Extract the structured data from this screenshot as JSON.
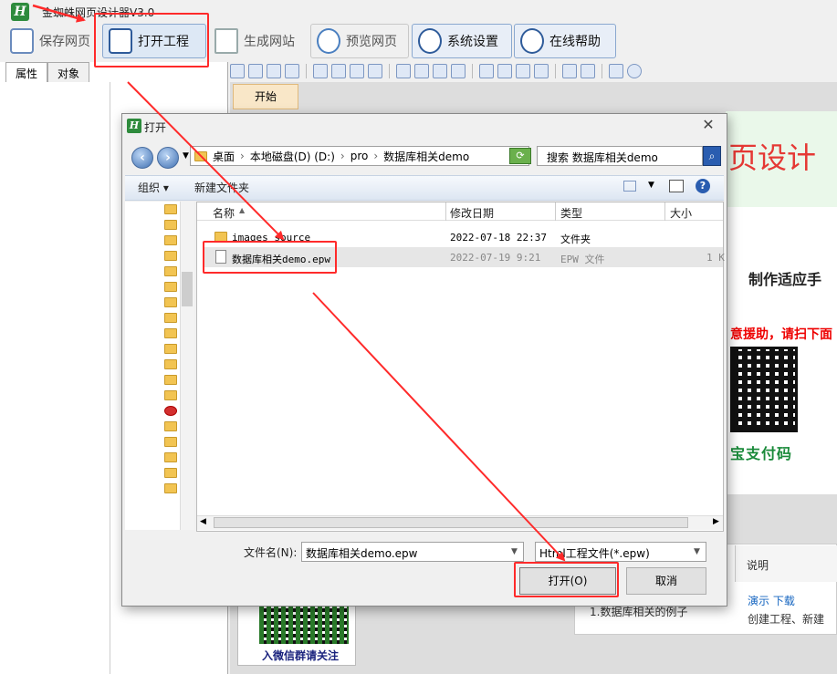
{
  "app": {
    "title": "金蜘蛛网页设计器V3.0",
    "logo_letter": "H"
  },
  "toolbar": {
    "save": "保存网页",
    "open": "打开工程",
    "generate": "生成网站",
    "preview": "预览网页",
    "settings": "系统设置",
    "help": "在线帮助"
  },
  "left_panel": {
    "tabs": [
      "属性",
      "对象"
    ]
  },
  "editor": {
    "tab": "开始",
    "banner_text": "页设计",
    "heading": "制作适应手",
    "red_text": "意援助，请扫下面",
    "alipay_text": "宝支付码",
    "table": {
      "column": "说明",
      "links": "演示 下载",
      "description": "创建工程、新建",
      "cell": "1.数据库相关的例子"
    },
    "wechat_text": "入微信群请关注"
  },
  "dialog": {
    "title": "打开",
    "logo_letter": "H",
    "close": "✕",
    "nav_back": "‹",
    "nav_forward": "›",
    "address": [
      "桌面",
      "本地磁盘(D) (D:)",
      "pro",
      "数据库相关demo"
    ],
    "search_placeholder": "搜索 数据库相关demo",
    "search_icon": "search-icon",
    "organize": "组织 ▾",
    "new_folder": "新建文件夹",
    "columns": [
      "名称",
      "修改日期",
      "类型",
      "大小"
    ],
    "files": [
      {
        "name": "images source",
        "date": "2022-07-18 22:37",
        "type": "文件夹",
        "size": ""
      },
      {
        "name": "数据库相关demo.epw",
        "date": "2022-07-19 9:21",
        "type": "EPW 文件",
        "size": "1 K"
      }
    ],
    "filename_label": "文件名(N):",
    "filename_value": "数据库相关demo.epw",
    "filter_value": "Html工程文件(*.epw)",
    "open_button": "打开(O)",
    "cancel_button": "取消"
  },
  "colors": {
    "annotation_red": "#ff2a2a",
    "brand_green": "#2e8b3d",
    "selected_row": "#e6e6e6"
  }
}
